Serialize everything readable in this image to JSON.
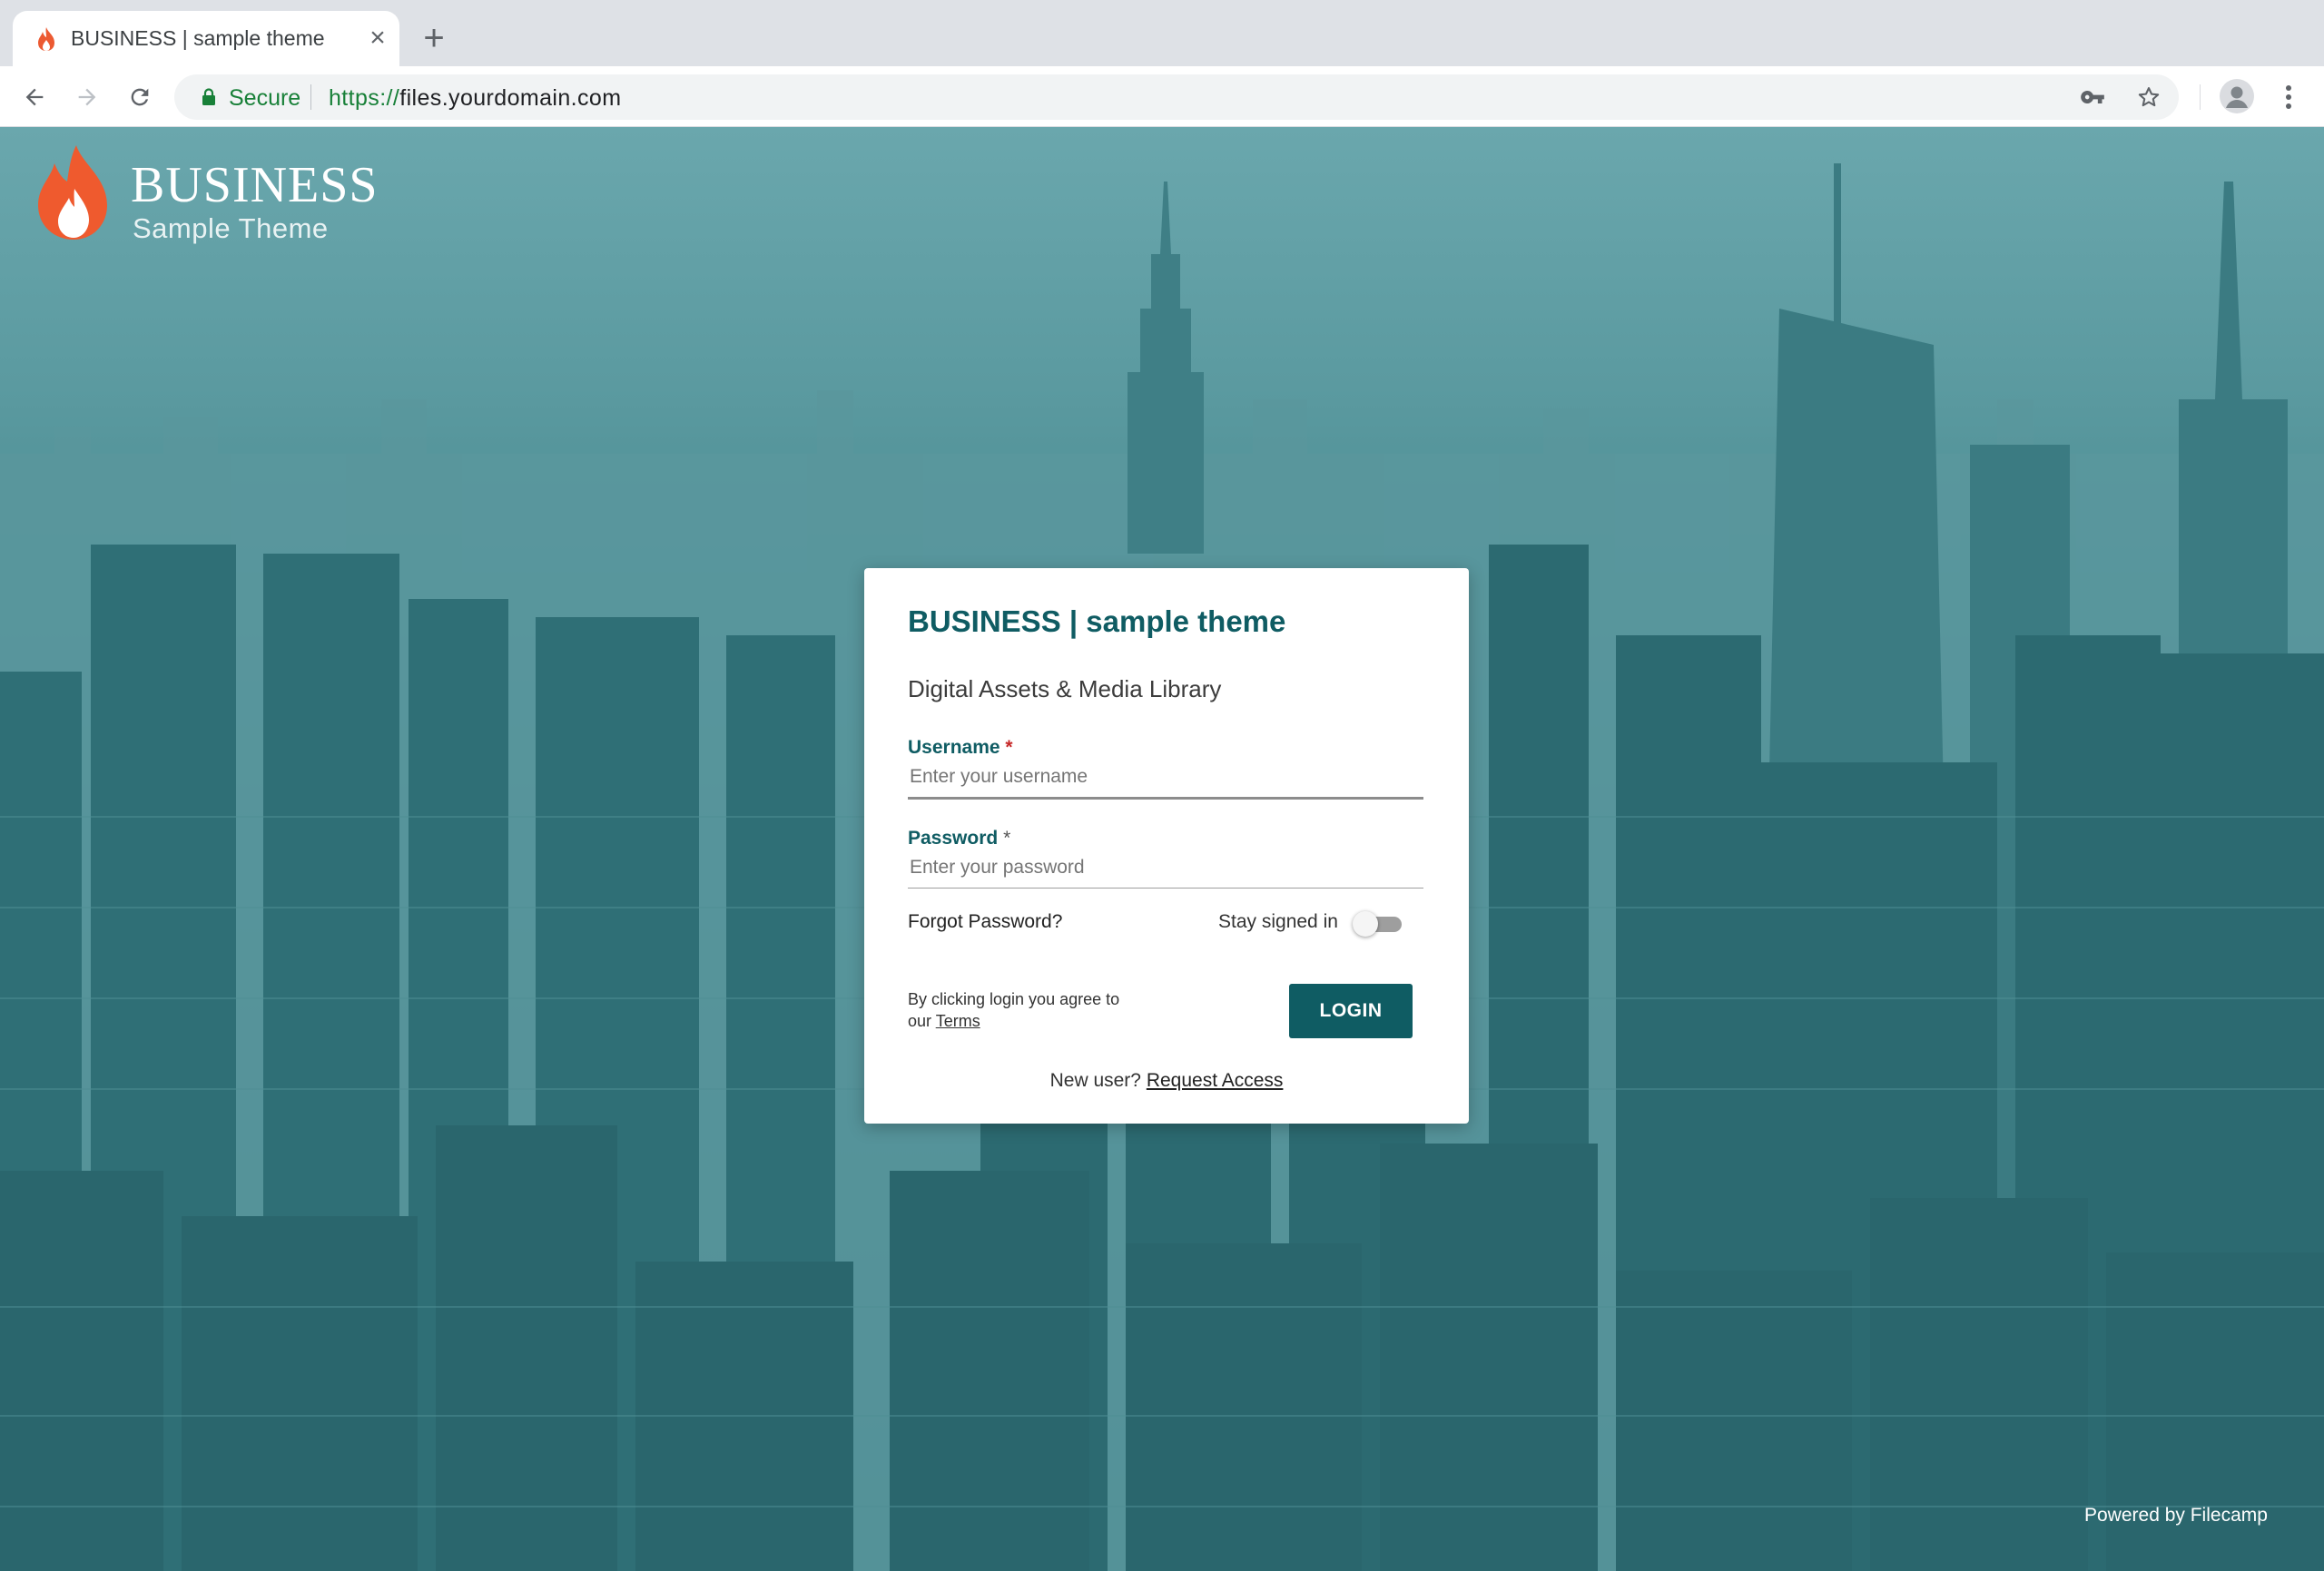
{
  "browser": {
    "tab_title": "BUSINESS | sample theme",
    "new_tab_symbol": "+",
    "close_symbol": "×",
    "secure_label": "Secure",
    "url_scheme": "https://",
    "url_rest": "files.yourdomain.com"
  },
  "brand": {
    "name": "BUSINESS",
    "tagline": "Sample Theme",
    "flame_colors": [
      "#f26a3a",
      "#e8453c",
      "#ffffff"
    ]
  },
  "login": {
    "title": "BUSINESS | sample theme",
    "subtitle": "Digital Assets & Media Library",
    "username_label": "Username",
    "username_placeholder": "Enter your username",
    "password_label": "Password",
    "password_placeholder": "Enter your password",
    "required_mark": "*",
    "forgot_password": "Forgot Password?",
    "stay_signed_in": "Stay signed in",
    "stay_signed_in_enabled": false,
    "terms_prefix": "By clicking login you agree to our ",
    "terms_link": "Terms",
    "login_button": "LOGIN",
    "new_user_prefix": "New user? ",
    "request_access": "Request Access"
  },
  "footer": {
    "powered_by": "Powered by Filecamp"
  },
  "colors": {
    "accent": "#0f5c63",
    "required": "#c62828",
    "secure_green": "#188038",
    "background_tint": "#3d8086"
  },
  "icons": {
    "back": "back-arrow-icon",
    "forward": "forward-arrow-icon",
    "reload": "reload-icon",
    "lock": "lock-icon",
    "key": "key-icon",
    "bookmark": "star-icon",
    "profile": "profile-icon",
    "menu": "kebab-menu-icon",
    "flame": "flame-icon"
  }
}
